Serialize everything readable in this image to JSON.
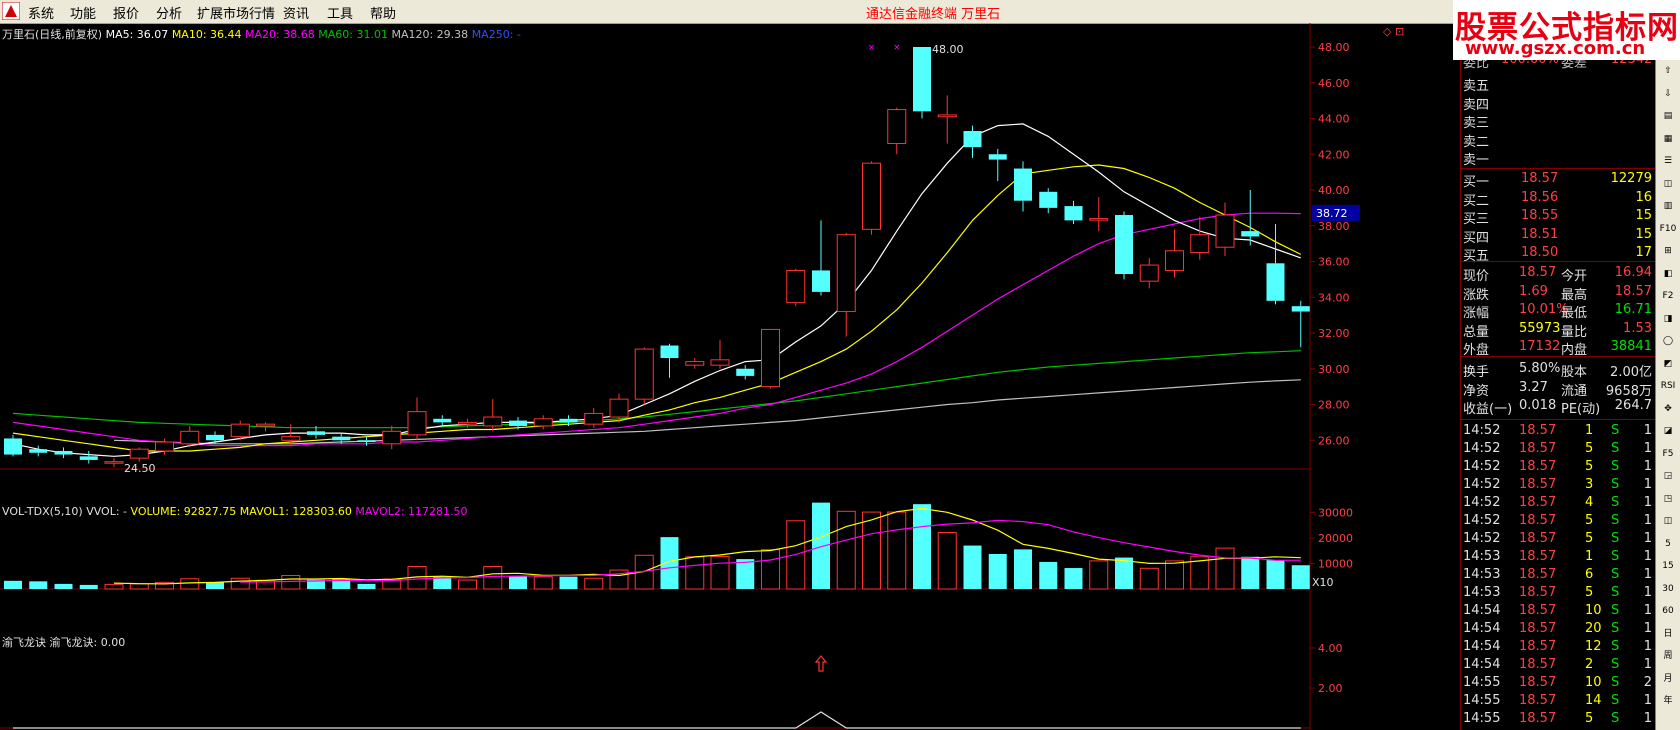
{
  "menu": {
    "items": [
      "系统",
      "功能",
      "报价",
      "分析",
      "扩展市场行情",
      "资讯",
      "工具",
      "帮助"
    ],
    "window_title": "通达信金融终端    万里石"
  },
  "brand": {
    "line1": "股票公式指标网",
    "line2": "www.gszx.com.cn"
  },
  "legend_main": {
    "name": "万里石(日线,前复权)",
    "ma5": "MA5: 36.07",
    "ma10": "MA10: 36.44",
    "ma20": "MA20: 38.68",
    "ma60": "MA60: 31.01",
    "ma120": "MA120: 29.38",
    "ma250": "MA250: -"
  },
  "legend_vol": {
    "name": "VOL-TDX(5,10)",
    "vvol": "VVOL: -",
    "volume": "VOLUME: 92827.75",
    "mavol1": "MAVOL1: 128303.60",
    "mavol2": "MAVOL2: 117281.50"
  },
  "legend_ind": {
    "name": "渝飞龙诀",
    "value": "渝飞龙诀: 0.00"
  },
  "annotations": {
    "high": "48.00",
    "low": "24.50",
    "unit": "X10",
    "top_icons": "◇ ⊡"
  },
  "colors": {
    "up": "#ff3232",
    "down": "#54ffff",
    "ma5": "#ffffff",
    "ma10": "#ffff00",
    "ma20": "#ff00ff",
    "ma60": "#00c000",
    "ma120": "#c0c0c0",
    "grid": "#800000"
  },
  "chart_data": [
    {
      "type": "candlestick",
      "ylim": [
        24.5,
        48.5
      ],
      "y_ticks": [
        "48.00",
        "46.00",
        "44.00",
        "42.00",
        "40.00",
        "38.00",
        "36.00",
        "34.00",
        "32.00",
        "30.00",
        "28.00",
        "26.00"
      ],
      "current_price_tag": "38.72",
      "candles": [
        {
          "o": 26.1,
          "c": 25.2,
          "h": 26.3,
          "l": 25.1
        },
        {
          "o": 25.5,
          "c": 25.3,
          "h": 25.7,
          "l": 25.1
        },
        {
          "o": 25.4,
          "c": 25.2,
          "h": 25.6,
          "l": 25.0
        },
        {
          "o": 25.1,
          "c": 24.9,
          "h": 25.4,
          "l": 24.7
        },
        {
          "o": 24.8,
          "c": 24.8,
          "h": 25.0,
          "l": 24.5
        },
        {
          "o": 25.0,
          "c": 25.5,
          "h": 25.6,
          "l": 24.8
        },
        {
          "o": 25.4,
          "c": 25.9,
          "h": 26.1,
          "l": 25.2
        },
        {
          "o": 25.8,
          "c": 26.5,
          "h": 26.8,
          "l": 25.6
        },
        {
          "o": 26.3,
          "c": 26.0,
          "h": 26.5,
          "l": 25.8
        },
        {
          "o": 26.2,
          "c": 26.9,
          "h": 27.1,
          "l": 26.0
        },
        {
          "o": 26.8,
          "c": 26.9,
          "h": 27.0,
          "l": 26.5
        },
        {
          "o": 26.0,
          "c": 26.2,
          "h": 26.9,
          "l": 25.7
        },
        {
          "o": 26.5,
          "c": 26.3,
          "h": 26.8,
          "l": 26.1
        },
        {
          "o": 26.2,
          "c": 26.0,
          "h": 26.4,
          "l": 25.8
        },
        {
          "o": 26.0,
          "c": 25.9,
          "h": 26.2,
          "l": 25.7
        },
        {
          "o": 25.8,
          "c": 26.5,
          "h": 26.8,
          "l": 25.5
        },
        {
          "o": 26.3,
          "c": 27.6,
          "h": 28.4,
          "l": 26.0
        },
        {
          "o": 27.2,
          "c": 27.0,
          "h": 27.4,
          "l": 26.8
        },
        {
          "o": 26.9,
          "c": 27.0,
          "h": 27.2,
          "l": 26.7
        },
        {
          "o": 26.8,
          "c": 27.3,
          "h": 28.3,
          "l": 26.5
        },
        {
          "o": 27.1,
          "c": 26.8,
          "h": 27.3,
          "l": 26.6
        },
        {
          "o": 26.8,
          "c": 27.2,
          "h": 27.4,
          "l": 26.6
        },
        {
          "o": 27.2,
          "c": 27.0,
          "h": 27.4,
          "l": 26.8
        },
        {
          "o": 26.9,
          "c": 27.5,
          "h": 27.8,
          "l": 26.7
        },
        {
          "o": 27.3,
          "c": 28.3,
          "h": 28.6,
          "l": 27.0
        },
        {
          "o": 28.3,
          "c": 31.1,
          "h": 31.2,
          "l": 28.0
        },
        {
          "o": 31.3,
          "c": 30.6,
          "h": 31.4,
          "l": 29.5
        },
        {
          "o": 30.2,
          "c": 30.4,
          "h": 30.6,
          "l": 30.0
        },
        {
          "o": 30.2,
          "c": 30.5,
          "h": 31.6,
          "l": 30.0
        },
        {
          "o": 30.0,
          "c": 29.6,
          "h": 30.2,
          "l": 29.4
        },
        {
          "o": 29.0,
          "c": 32.2,
          "h": 32.2,
          "l": 28.9
        },
        {
          "o": 33.7,
          "c": 35.5,
          "h": 35.6,
          "l": 33.5
        },
        {
          "o": 35.5,
          "c": 34.3,
          "h": 38.3,
          "l": 34.1
        },
        {
          "o": 33.2,
          "c": 37.5,
          "h": 37.6,
          "l": 31.8
        },
        {
          "o": 37.8,
          "c": 41.5,
          "h": 41.6,
          "l": 37.5
        },
        {
          "o": 42.6,
          "c": 44.5,
          "h": 44.6,
          "l": 42.0
        },
        {
          "o": 48.0,
          "c": 44.4,
          "h": 48.0,
          "l": 44.0
        },
        {
          "o": 44.1,
          "c": 44.2,
          "h": 45.3,
          "l": 42.6
        },
        {
          "o": 43.3,
          "c": 42.4,
          "h": 43.6,
          "l": 41.8
        },
        {
          "o": 42.0,
          "c": 41.7,
          "h": 42.3,
          "l": 40.5
        },
        {
          "o": 41.2,
          "c": 39.4,
          "h": 41.6,
          "l": 38.8
        },
        {
          "o": 39.9,
          "c": 39.0,
          "h": 40.1,
          "l": 38.7
        },
        {
          "o": 39.1,
          "c": 38.3,
          "h": 39.4,
          "l": 38.1
        },
        {
          "o": 38.4,
          "c": 38.4,
          "h": 39.6,
          "l": 37.7
        },
        {
          "o": 38.6,
          "c": 35.3,
          "h": 38.8,
          "l": 35.0
        },
        {
          "o": 34.9,
          "c": 35.8,
          "h": 36.2,
          "l": 34.5
        },
        {
          "o": 35.5,
          "c": 36.6,
          "h": 37.8,
          "l": 35.1
        },
        {
          "o": 36.5,
          "c": 37.5,
          "h": 38.5,
          "l": 36.1
        },
        {
          "o": 36.8,
          "c": 38.6,
          "h": 39.3,
          "l": 36.3
        },
        {
          "o": 37.7,
          "c": 37.4,
          "h": 40.0,
          "l": 36.9
        },
        {
          "o": 35.9,
          "c": 33.8,
          "h": 38.1,
          "l": 33.6
        },
        {
          "o": 33.5,
          "c": 33.2,
          "h": 33.8,
          "l": 31.2
        }
      ],
      "ma5": [
        25.8,
        25.5,
        25.3,
        25.2,
        25.1,
        25.2,
        25.4,
        25.7,
        25.9,
        26.1,
        26.3,
        26.4,
        26.4,
        26.4,
        26.3,
        26.3,
        26.6,
        26.8,
        26.9,
        27.0,
        27.0,
        27.0,
        27.1,
        27.2,
        27.4,
        28.0,
        28.6,
        29.3,
        29.9,
        30.4,
        30.5,
        31.5,
        32.4,
        33.7,
        35.5,
        37.7,
        39.8,
        41.5,
        43.0,
        43.6,
        43.7,
        43.0,
        42.0,
        41.0,
        39.9,
        39.1,
        38.3,
        37.7,
        37.3,
        37.2,
        36.7,
        36.2
      ],
      "ma10": [
        26.4,
        26.2,
        26.0,
        25.8,
        25.6,
        25.4,
        25.4,
        25.4,
        25.5,
        25.6,
        25.8,
        25.9,
        26.0,
        26.1,
        26.2,
        26.3,
        26.4,
        26.5,
        26.6,
        26.6,
        26.7,
        26.8,
        26.9,
        27.0,
        27.1,
        27.4,
        27.7,
        28.1,
        28.4,
        28.8,
        29.2,
        29.8,
        30.4,
        31.1,
        32.1,
        33.3,
        34.8,
        36.5,
        38.3,
        39.7,
        40.9,
        41.1,
        41.3,
        41.4,
        41.2,
        40.7,
        40.1,
        39.3,
        38.6,
        37.9,
        37.1,
        36.4
      ],
      "ma20": [
        27.0,
        26.8,
        26.6,
        26.4,
        26.2,
        26.0,
        25.9,
        25.8,
        25.7,
        25.7,
        25.7,
        25.7,
        25.8,
        25.8,
        25.8,
        25.9,
        25.9,
        26.0,
        26.1,
        26.2,
        26.3,
        26.4,
        26.5,
        26.6,
        26.7,
        26.9,
        27.1,
        27.3,
        27.5,
        27.8,
        28.0,
        28.4,
        28.8,
        29.2,
        29.7,
        30.4,
        31.2,
        32.1,
        33.0,
        33.9,
        34.7,
        35.5,
        36.3,
        37.0,
        37.5,
        37.8,
        38.1,
        38.4,
        38.6,
        38.7,
        38.7,
        38.68
      ],
      "ma60": [
        27.5,
        27.4,
        27.3,
        27.2,
        27.1,
        27.0,
        26.95,
        26.9,
        26.85,
        26.8,
        26.75,
        26.7,
        26.7,
        26.7,
        26.7,
        26.7,
        26.7,
        26.75,
        26.8,
        26.85,
        26.9,
        26.95,
        27.0,
        27.1,
        27.2,
        27.3,
        27.45,
        27.6,
        27.75,
        27.9,
        28.05,
        28.2,
        28.4,
        28.6,
        28.8,
        29.0,
        29.2,
        29.4,
        29.6,
        29.8,
        29.95,
        30.1,
        30.2,
        30.3,
        30.4,
        30.5,
        30.6,
        30.7,
        30.8,
        30.9,
        30.95,
        31.01
      ],
      "ma120": [
        null,
        null,
        null,
        null,
        26.0,
        25.95,
        25.9,
        25.85,
        25.8,
        25.8,
        25.8,
        25.8,
        25.85,
        25.9,
        25.95,
        26.0,
        26.05,
        26.1,
        26.15,
        26.2,
        26.25,
        26.3,
        26.35,
        26.4,
        26.45,
        26.5,
        26.6,
        26.7,
        26.8,
        26.9,
        27.0,
        27.1,
        27.25,
        27.4,
        27.55,
        27.7,
        27.85,
        28.0,
        28.1,
        28.25,
        28.35,
        28.45,
        28.55,
        28.65,
        28.75,
        28.85,
        28.95,
        29.05,
        29.15,
        29.25,
        29.32,
        29.38
      ]
    },
    {
      "type": "bar",
      "title": "VOL-TDX(5,10)",
      "ylim": [
        0,
        36000
      ],
      "y_ticks": [
        "30000",
        "20000",
        "10000"
      ],
      "values": [
        3200,
        3000,
        2000,
        1600,
        1800,
        2000,
        2600,
        4000,
        2600,
        4200,
        3400,
        5300,
        3600,
        3800,
        2000,
        3900,
        8800,
        4800,
        3500,
        8800,
        4900,
        4800,
        4800,
        4200,
        7400,
        13200,
        20300,
        12600,
        12700,
        11700,
        15400,
        26700,
        33800,
        30400,
        30100,
        30100,
        33200,
        22100,
        17000,
        13700,
        15500,
        10600,
        8200,
        11000,
        12300,
        8100,
        11000,
        12600,
        16000,
        12600,
        11300,
        9300
      ],
      "mavol1": [
        null,
        null,
        null,
        null,
        2320,
        2080,
        2000,
        2400,
        2600,
        3080,
        3360,
        3900,
        3900,
        4100,
        3580,
        3800,
        4720,
        5000,
        4580,
        5960,
        6160,
        5360,
        5360,
        5700,
        5280,
        6880,
        10820,
        12560,
        13320,
        14640,
        15060,
        16940,
        20340,
        24400,
        27040,
        30230,
        31500,
        30000,
        27000,
        23000,
        17500,
        15900,
        13900,
        11700,
        11100,
        10000,
        10100,
        11000,
        12000,
        12000,
        12600,
        12260
      ],
      "mavol2": [
        null,
        null,
        null,
        null,
        null,
        null,
        null,
        null,
        null,
        2700,
        2740,
        2970,
        3130,
        3350,
        3310,
        3300,
        3920,
        4350,
        4470,
        4930,
        5030,
        5180,
        5300,
        5340,
        5980,
        6910,
        8280,
        9240,
        10110,
        10400,
        11340,
        13530,
        16570,
        19140,
        21620,
        23130,
        24410,
        25400,
        25870,
        26880,
        26370,
        25160,
        22350,
        20120,
        18100,
        16450,
        14660,
        13280,
        12170,
        12150,
        11220,
        11270
      ]
    },
    {
      "type": "line",
      "title": "渝飞龙诀",
      "ylim": [
        0,
        5.5
      ],
      "y_ticks": [
        "4.00",
        "2.00"
      ],
      "values": [
        0,
        0,
        0,
        0,
        0,
        0,
        0,
        0,
        0,
        0,
        0,
        0,
        0,
        0,
        0,
        0,
        0,
        0,
        0,
        0,
        0,
        0,
        0,
        0,
        0,
        0,
        0,
        0,
        0,
        0,
        0,
        0,
        0.8,
        0,
        0,
        0,
        0,
        0,
        0,
        0,
        0,
        0,
        0,
        0,
        0,
        0,
        0,
        0,
        0,
        0,
        0,
        0
      ]
    }
  ],
  "quote_panel": {
    "sell_partial": {
      "label": "委比",
      "value": "100.00%",
      "label2": "委差",
      "value2": "12342"
    },
    "sell": [
      {
        "label": "卖五"
      },
      {
        "label": "卖四"
      },
      {
        "label": "卖三"
      },
      {
        "label": "卖二"
      },
      {
        "label": "卖一"
      }
    ],
    "buy": [
      {
        "label": "买一",
        "price": "18.57",
        "vol": "12279"
      },
      {
        "label": "买二",
        "price": "18.56",
        "vol": "16"
      },
      {
        "label": "买三",
        "price": "18.55",
        "vol": "15"
      },
      {
        "label": "买四",
        "price": "18.51",
        "vol": "15"
      },
      {
        "label": "买五",
        "price": "18.50",
        "vol": "17"
      }
    ],
    "stats": [
      {
        "l1": "现价",
        "v1": "18.57",
        "c1": "red",
        "l2": "今开",
        "v2": "16.94",
        "c2": "red"
      },
      {
        "l1": "涨跌",
        "v1": "1.69",
        "c1": "red",
        "l2": "最高",
        "v2": "18.57",
        "c2": "red"
      },
      {
        "l1": "涨幅",
        "v1": "10.01%",
        "c1": "red",
        "l2": "最低",
        "v2": "16.71",
        "c2": "grn"
      },
      {
        "l1": "总量",
        "v1": "55973",
        "c1": "yel",
        "l2": "量比",
        "v2": "1.53",
        "c2": "red"
      },
      {
        "l1": "外盘",
        "v1": "17132",
        "c1": "red",
        "l2": "内盘",
        "v2": "38841",
        "c2": "grn"
      }
    ],
    "stats2": [
      {
        "l1": "换手",
        "v1": "5.80%",
        "l2": "股本",
        "v2": "2.00亿"
      },
      {
        "l1": "净资",
        "v1": "3.27",
        "l2": "流通",
        "v2": "9658万"
      },
      {
        "l1": "收益(一)",
        "v1": "0.018",
        "l2": "PE(动)",
        "v2": "264.7"
      }
    ],
    "ticks": [
      {
        "t": "14:52",
        "p": "18.57",
        "v": "1",
        "d": "S",
        "n": "1"
      },
      {
        "t": "14:52",
        "p": "18.57",
        "v": "5",
        "d": "S",
        "n": "1"
      },
      {
        "t": "14:52",
        "p": "18.57",
        "v": "5",
        "d": "S",
        "n": "1"
      },
      {
        "t": "14:52",
        "p": "18.57",
        "v": "3",
        "d": "S",
        "n": "1"
      },
      {
        "t": "14:52",
        "p": "18.57",
        "v": "4",
        "d": "S",
        "n": "1"
      },
      {
        "t": "14:52",
        "p": "18.57",
        "v": "5",
        "d": "S",
        "n": "1"
      },
      {
        "t": "14:52",
        "p": "18.57",
        "v": "5",
        "d": "S",
        "n": "1"
      },
      {
        "t": "14:53",
        "p": "18.57",
        "v": "1",
        "d": "S",
        "n": "1"
      },
      {
        "t": "14:53",
        "p": "18.57",
        "v": "6",
        "d": "S",
        "n": "1"
      },
      {
        "t": "14:53",
        "p": "18.57",
        "v": "5",
        "d": "S",
        "n": "1"
      },
      {
        "t": "14:54",
        "p": "18.57",
        "v": "10",
        "d": "S",
        "n": "1"
      },
      {
        "t": "14:54",
        "p": "18.57",
        "v": "20",
        "d": "S",
        "n": "1"
      },
      {
        "t": "14:54",
        "p": "18.57",
        "v": "12",
        "d": "S",
        "n": "1"
      },
      {
        "t": "14:54",
        "p": "18.57",
        "v": "2",
        "d": "S",
        "n": "1"
      },
      {
        "t": "14:55",
        "p": "18.57",
        "v": "10",
        "d": "S",
        "n": "2"
      },
      {
        "t": "14:55",
        "p": "18.57",
        "v": "14",
        "d": "S",
        "n": "1"
      },
      {
        "t": "14:55",
        "p": "18.57",
        "v": "5",
        "d": "S",
        "n": "1"
      }
    ]
  },
  "toolbar": {
    "buttons": [
      "⇧",
      "⇩",
      "▤",
      "▦",
      "☰",
      "◫",
      "▥",
      "F10",
      "⊞",
      "◧",
      "F2",
      "◨",
      "◯",
      "◩",
      "RSI",
      "✥",
      "◪",
      "F5",
      "◲",
      "◳",
      "◫",
      "5",
      "15",
      "30",
      "60",
      "日",
      "周",
      "月",
      "年"
    ]
  }
}
